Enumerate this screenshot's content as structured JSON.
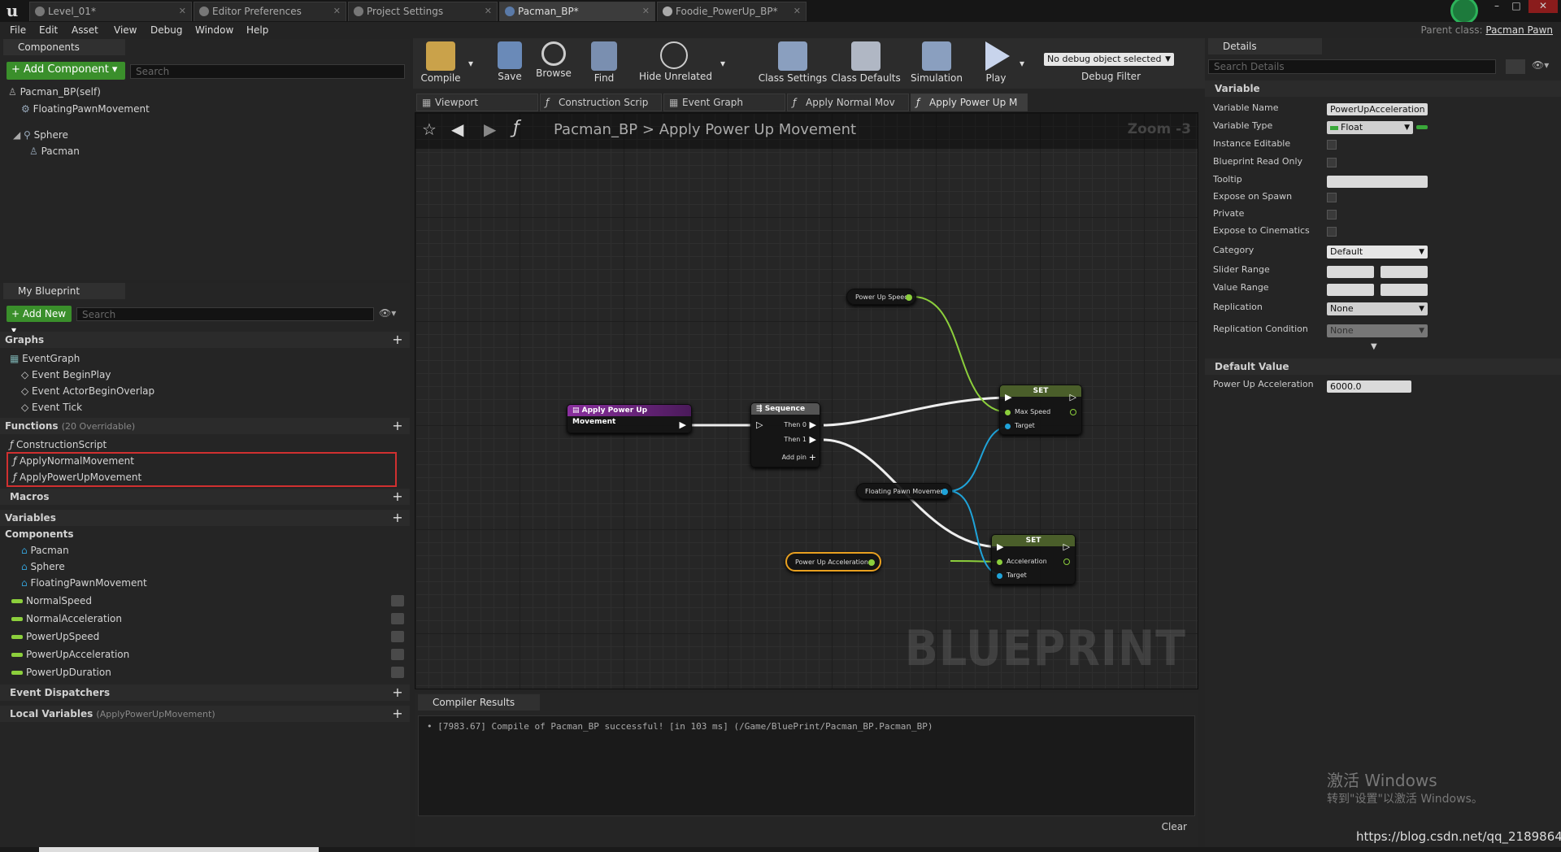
{
  "window": {
    "tabs": [
      {
        "label": "Level_01*",
        "active": false
      },
      {
        "label": "Editor Preferences",
        "active": false
      },
      {
        "label": "Project Settings",
        "active": false
      },
      {
        "label": "Pacman_BP*",
        "active": true
      },
      {
        "label": "Foodie_PowerUp_BP*",
        "active": false
      }
    ],
    "controls": [
      "–",
      "□",
      "✕"
    ]
  },
  "menubar": {
    "items": [
      "File",
      "Edit",
      "Asset",
      "View",
      "Debug",
      "Window",
      "Help"
    ],
    "parent_class_label": "Parent class:",
    "parent_class_value": "Pacman Pawn"
  },
  "components_panel": {
    "tab": "Components",
    "add_button": "+ Add Component ▾",
    "search_placeholder": "Search",
    "tree": [
      "Pacman_BP(self)",
      "FloatingPawnMovement",
      "Sphere",
      "Pacman"
    ]
  },
  "my_blueprint": {
    "tab": "My Blueprint",
    "add_button": "+ Add New ▾",
    "search_placeholder": "Search",
    "graphs_header": "Graphs",
    "graphs": [
      "EventGraph",
      "Event BeginPlay",
      "Event ActorBeginOverlap",
      "Event Tick"
    ],
    "functions_header": "Functions",
    "functions_note": "(20 Overridable)",
    "functions": [
      "ConstructionScript",
      "ApplyNormalMovement",
      "ApplyPowerUpMovement"
    ],
    "macros_header": "Macros",
    "variables_header": "Variables",
    "components_header": "Components",
    "component_vars": [
      "Pacman",
      "Sphere",
      "FloatingPawnMovement"
    ],
    "variables": [
      "NormalSpeed",
      "NormalAcceleration",
      "PowerUpSpeed",
      "PowerUpAcceleration",
      "PowerUpDuration"
    ],
    "dispatchers_header": "Event Dispatchers",
    "local_vars_header": "Local Variables",
    "local_vars_note": "(ApplyPowerUpMovement)"
  },
  "toolbar": {
    "buttons": [
      "Compile",
      "Save",
      "Browse",
      "Find",
      "Hide Unrelated",
      "Class Settings",
      "Class Defaults",
      "Simulation",
      "Play"
    ],
    "debug_select": "No debug object selected",
    "debug_filter": "Debug Filter"
  },
  "graph_tabs": [
    "Viewport",
    "Construction Scrip",
    "Event Graph",
    "Apply Normal Mov",
    "Apply Power Up M"
  ],
  "graph": {
    "breadcrumb_root": "Pacman_BP",
    "breadcrumb_sep": ">",
    "breadcrumb_current": "Apply Power Up Movement",
    "zoom": "Zoom -3",
    "watermark": "BLUEPRINT",
    "nodes": {
      "entry": "Apply Power Up Movement",
      "sequence": "Sequence",
      "then0": "Then 0",
      "then1": "Then 1",
      "add_pin": "Add pin",
      "power_up_speed": "Power Up Speed",
      "set1_title": "SET",
      "max_speed": "Max Speed",
      "target1": "Target",
      "floating_pawn": "Floating Pawn Movement",
      "set2_title": "SET",
      "acceleration": "Acceleration",
      "target2": "Target",
      "power_up_accel": "Power Up Acceleration"
    },
    "colors": {
      "exec": "#ffffff",
      "float": "#8ccf3c",
      "object": "#1fa3d9",
      "function_header": "#6a2a7a"
    }
  },
  "compiler": {
    "tab": "Compiler Results",
    "message": "[7983.67] Compile of Pacman_BP successful! [in 103 ms] (/Game/BluePrint/Pacman_BP.Pacman_BP)",
    "clear": "Clear"
  },
  "details": {
    "tab": "Details",
    "search_placeholder": "Search Details",
    "variable_header": "Variable",
    "rows": {
      "variable_name_label": "Variable Name",
      "variable_name_value": "PowerUpAcceleration",
      "variable_type_label": "Variable Type",
      "variable_type_value": "Float",
      "instance_editable": "Instance Editable",
      "read_only": "Blueprint Read Only",
      "tooltip": "Tooltip",
      "expose_spawn": "Expose on Spawn",
      "private": "Private",
      "expose_cinematics": "Expose to Cinematics",
      "category_label": "Category",
      "category_value": "Default",
      "slider_range": "Slider Range",
      "value_range": "Value Range",
      "replication_label": "Replication",
      "replication_value": "None",
      "replication_cond_label": "Replication Condition",
      "replication_cond_value": "None"
    },
    "default_header": "Default Value",
    "default_label": "Power Up Acceleration",
    "default_value": "6000.0"
  },
  "overlay": {
    "activate_line1": "激活 Windows",
    "activate_line2": "转到\"设置\"以激活 Windows。",
    "url": "https://blog.csdn.net/qq_21898647"
  }
}
